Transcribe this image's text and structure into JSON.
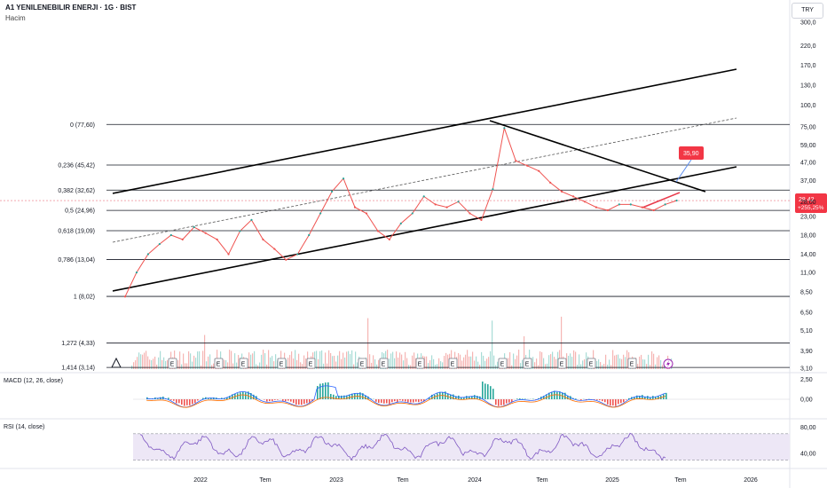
{
  "header": {
    "symbol_title": "A1 YENILENEBILIR ENERJI · 1G · BIST",
    "volume_label": "Hacim",
    "currency": "TRY"
  },
  "colors": {
    "up": "#26a69a",
    "down": "#ef5350",
    "price_line": "#e8394a",
    "badge_bg": "#f23645",
    "macd_line": "#2962ff",
    "signal_line": "#ff6d00",
    "rsi_line": "#7e57c2",
    "rsi_band": "#ede7f6",
    "fib_line": "#131722",
    "trend_line": "#000000",
    "arrow": "#5b8def"
  },
  "chart_data": [
    {
      "type": "line",
      "title": "A1 YENILENEBILIR ENERJI · 1G · BIST",
      "scale": "log",
      "ylim": [
        3.0,
        310.0
      ],
      "y_ticks": [
        "300,0",
        "220,0",
        "170,0",
        "130,0",
        "100,0",
        "75,00",
        "59,00",
        "47,00",
        "37,00",
        "28,00",
        "23,00",
        "18,00",
        "14,00",
        "11,00",
        "8,50",
        "6,50",
        "5,10",
        "3,90",
        "3,10"
      ],
      "x_ticks": [
        "2022",
        "Tem",
        "2023",
        "Tem",
        "2024",
        "Tem",
        "2025",
        "Tem",
        "2026"
      ],
      "series": [
        {
          "x": [
            "2021-05",
            "2021-06",
            "2021-07",
            "2021-08",
            "2021-09",
            "2021-10",
            "2021-11",
            "2021-12",
            "2022-01",
            "2022-02",
            "2022-03",
            "2022-04",
            "2022-05",
            "2022-06",
            "2022-07",
            "2022-08",
            "2022-09",
            "2022-10",
            "2022-11",
            "2022-12",
            "2023-01",
            "2023-02",
            "2023-03",
            "2023-04",
            "2023-05",
            "2023-06",
            "2023-07",
            "2023-08",
            "2023-09",
            "2023-10",
            "2023-11",
            "2023-12",
            "2024-01",
            "2024-02",
            "2024-03",
            "2024-04",
            "2024-05",
            "2024-06",
            "2024-07",
            "2024-08",
            "2024-09",
            "2024-10",
            "2024-11",
            "2024-12",
            "2025-01",
            "2025-02",
            "2025-03",
            "2025-04",
            "2025-05"
          ],
          "values": [
            8.0,
            11.0,
            14.0,
            16.0,
            18.0,
            17.0,
            20.0,
            18.5,
            17.0,
            14.0,
            19.0,
            22.0,
            17.0,
            15.0,
            13.0,
            14.0,
            18.0,
            24.0,
            32.0,
            38.0,
            26.0,
            24.0,
            19.0,
            17.0,
            21.0,
            24.0,
            30.0,
            27.0,
            26.0,
            28.0,
            24.0,
            22.0,
            33.0,
            74.0,
            48.0,
            45.0,
            42.0,
            36.0,
            32.0,
            30.0,
            28.0,
            26.0,
            25.0,
            27.0,
            27.0,
            26.0,
            25.0,
            27.0,
            28.42
          ]
        }
      ],
      "fibonacci": [
        {
          "label": "0 (77,60)",
          "value": 77.6
        },
        {
          "label": "0,236 (45,42)",
          "value": 45.42
        },
        {
          "label": "0,382 (32,62)",
          "value": 32.62
        },
        {
          "label": "0,5 (24,96)",
          "value": 24.96
        },
        {
          "label": "0,618 (19,09)",
          "value": 19.09
        },
        {
          "label": "0,786 (13,04)",
          "value": 13.04
        },
        {
          "label": "1 (8,02)",
          "value": 8.02
        },
        {
          "label": "1,272 (4,33)",
          "value": 4.33
        },
        {
          "label": "1,414 (3,14)",
          "value": 3.14
        }
      ],
      "annotations": {
        "target": "35,90",
        "last_price": "28,42",
        "change": "+255,25%"
      },
      "earnings_marker": "E"
    },
    {
      "type": "line",
      "title": "MACD (12, 26, close)",
      "y_ticks": [
        "2,50",
        "0,00"
      ],
      "series": [
        {
          "name": "MACD"
        },
        {
          "name": "Signal"
        },
        {
          "name": "Histogram"
        }
      ]
    },
    {
      "type": "line",
      "title": "RSI (14, close)",
      "y_ticks": [
        "80,00",
        "40,00"
      ],
      "series": [
        {
          "name": "RSI"
        }
      ]
    }
  ]
}
